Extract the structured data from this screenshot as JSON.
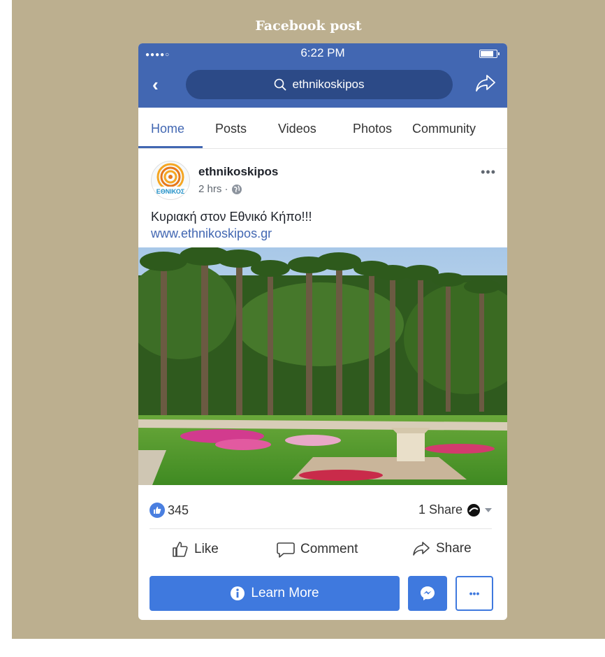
{
  "heading": "Facebook post",
  "status": {
    "signal_dots": "●●●●○",
    "time": "6:22 PM"
  },
  "search": {
    "value": "ethnikoskipos"
  },
  "tabs": [
    "Home",
    "Posts",
    "Videos",
    "Photos",
    "Community"
  ],
  "post": {
    "page_name": "ethnikoskipos",
    "time": "2 hrs ·",
    "text": "Κυριακή στον Εθνικό Κήπο!!!",
    "link": "www.ethnikoskipos.gr",
    "avatar_text": "ΕΘΝΙΚΟΣ"
  },
  "reactions": {
    "likes": "345",
    "shares": "1 Share"
  },
  "actions": {
    "like": "Like",
    "comment": "Comment",
    "share": "Share"
  },
  "cta": {
    "learn_more": "Learn More",
    "more": "•••"
  },
  "colors": {
    "brand": "#4267b2",
    "button": "#3f79de",
    "frame": "#bcaf8f"
  }
}
